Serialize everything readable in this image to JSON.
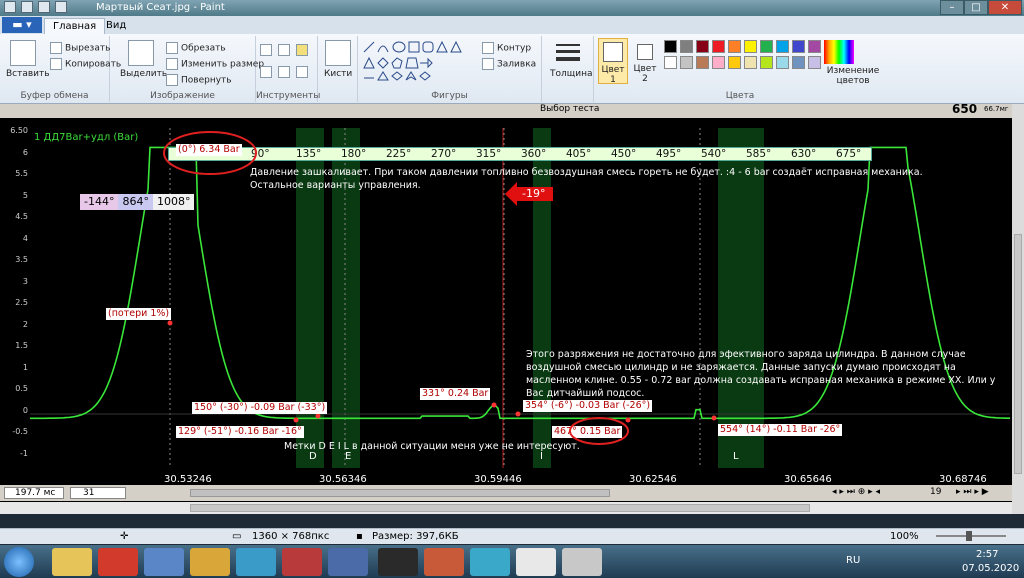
{
  "window": {
    "title": "Мартвый Сеат.jpg - Paint",
    "minimize": "–",
    "maximize": "□",
    "close": "✕"
  },
  "tabs": {
    "file": "▬ ▾",
    "home": "Главная",
    "view": "Вид"
  },
  "ribbon": {
    "clipboard": {
      "paste": "Вставить",
      "cut": "Вырезать",
      "copy": "Копировать",
      "label": "Буфер обмена"
    },
    "image": {
      "select": "Выделить",
      "crop": "Обрезать",
      "resize": "Изменить размер",
      "rotate": "Повернуть",
      "label": "Изображение"
    },
    "tools": {
      "label": "Инструменты"
    },
    "brushes": {
      "label": "Кисти"
    },
    "shapes": {
      "outline": "Контур",
      "fill": "Заливка",
      "label": "Фигуры"
    },
    "size": {
      "label": "Толщина"
    },
    "colors": {
      "color1": "Цвет 1",
      "color2": "Цвет 2",
      "edit": "Изменение цветов",
      "label": "Цвета",
      "palette": [
        "#000000",
        "#7f7f7f",
        "#880015",
        "#ed1c24",
        "#ff7f27",
        "#fff200",
        "#22b14c",
        "#00a2e8",
        "#3f48cc",
        "#a349a4",
        "#ffffff",
        "#c3c3c3",
        "#b97a57",
        "#ffaec9",
        "#ffc90e",
        "#efe4b0",
        "#b5e61d",
        "#99d9ea",
        "#7092be",
        "#c8bfe7"
      ]
    }
  },
  "toolstrip": {
    "select_test": "Выбор теста",
    "counter": "650",
    "counter_sub": "66.7мг"
  },
  "plot": {
    "channel": "1 ДД7Ваr+удл (Bar)",
    "angle_ticks": [
      "90°",
      "135°",
      "180°",
      "225°",
      "270°",
      "315°",
      "360°",
      "405°",
      "450°",
      "495°",
      "540°",
      "585°",
      "630°",
      "675°"
    ],
    "angle_box": "(0°) 6.34 Bar",
    "note1": "Давление зашкаливает. При таком давлении топливно безвоздушная смесь гореть не будет. :4 - 6 bar  создаёт исправная механика. Остальное варианты управления.",
    "note2": "Этого разряжения не достаточно для эфективного заряда цилиндра. В данном случае воздушной смесью цилиндр и не заряжается. Данные запуски думаю происходят на масленном клине. 0.55 - 0.72 ваr должна создавать исправная механика в режиме ХХ. Или у Вас дитчайший подсос.",
    "note3": "Метки D E I L в данной ситуации меня уже не интересуют.",
    "legend": {
      "a": "-144°",
      "b": "864°",
      "c": "1008°"
    },
    "red_arrow": "-19°",
    "losses": "(потери 1%)",
    "labels": [
      "150° (-30°) -0.09 Bar (-33°)",
      "129° (-51°) -0.16 Bar -16°",
      "331° 0.24 Bar",
      "354° (-6°) -0.03 Bar (-26°)",
      "467°",
      "0.15 Bar",
      "554° (14°) -0.11 Bar -26°"
    ],
    "markers": [
      "D",
      "E",
      "I",
      "L"
    ],
    "x_ticks": [
      "30.53246",
      "30.56346",
      "30.59446",
      "30.62546",
      "30.65646",
      "30.68746"
    ],
    "y_ticks": [
      "6.50",
      "6",
      "5.5",
      "5",
      "4.5",
      "4",
      "3.5",
      "3",
      "2.5",
      "2",
      "1.5",
      "1",
      "0.5",
      "0",
      "-0.5",
      "-1"
    ]
  },
  "bottom": {
    "timebase": "197.7 мс",
    "channel": "31",
    "page": "19"
  },
  "status": {
    "dims": "1360 × 768пкс",
    "size": "Размер: 397,6КБ",
    "zoom": "100%"
  },
  "taskbar": {
    "lang": "RU",
    "time": "2:57",
    "date": "07.05.2020"
  }
}
